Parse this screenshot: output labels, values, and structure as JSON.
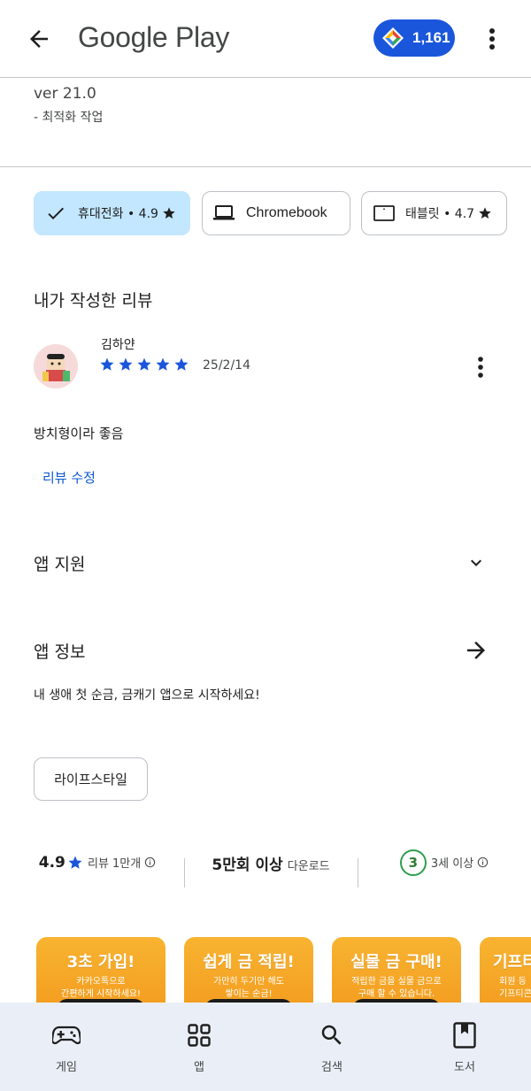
{
  "header": {
    "brand": "Google Play",
    "points": "1,161"
  },
  "whats_new": {
    "version": "ver 21.0",
    "note": "- 최적화 작업"
  },
  "devices": [
    {
      "label": "휴대전화 • 4.9",
      "selected": true
    },
    {
      "label": "Chromebook",
      "selected": false
    },
    {
      "label": "태블릿 • 4.7",
      "selected": false
    }
  ],
  "my_review": {
    "title": "내가 작성한 리뷰",
    "reviewer": "김하얀",
    "stars": 5,
    "date": "25/2/14",
    "text": "방치형이라 좋음",
    "edit_label": "리뷰 수정"
  },
  "app_support": {
    "title": "앱 지원"
  },
  "app_info": {
    "title": "앱 정보",
    "description": "내 생애 첫 순금, 금캐기 앱으로 시작하세요!",
    "category": "라이프스타일"
  },
  "stats": {
    "rating": "4.9",
    "rating_label": "리뷰 1만개",
    "downloads": "5만회 이상",
    "downloads_label": "다운로드",
    "age": "3",
    "age_label": "3세 이상"
  },
  "screenshots": [
    {
      "title": "3초 가입!",
      "subtitle": "카카오톡으로\n간편하게 시작하세요!"
    },
    {
      "title": "쉽게 금 적립!",
      "subtitle": "가만히 두기만 해도\n쌓이는 순금!"
    },
    {
      "title": "실물 금 구매!",
      "subtitle": "적립한 금을 실물 금으로\n구매 할 수 있습니다."
    },
    {
      "title": "기프티",
      "subtitle": "회원 등\n기프티콘"
    }
  ],
  "bottom_nav": [
    {
      "label": "게임",
      "icon": "gamepad-icon"
    },
    {
      "label": "앱",
      "icon": "apps-grid-icon"
    },
    {
      "label": "검색",
      "icon": "search-icon"
    },
    {
      "label": "도서",
      "icon": "book-icon"
    }
  ],
  "colors": {
    "accent": "#0b57d0",
    "points_pill": "#1a56db",
    "chip_selected": "#c2e7ff",
    "star": "#1a56db",
    "age_green": "#2e9e4f",
    "screenshot_orange": "#f6a623",
    "nav_bg": "#eaeff7"
  }
}
